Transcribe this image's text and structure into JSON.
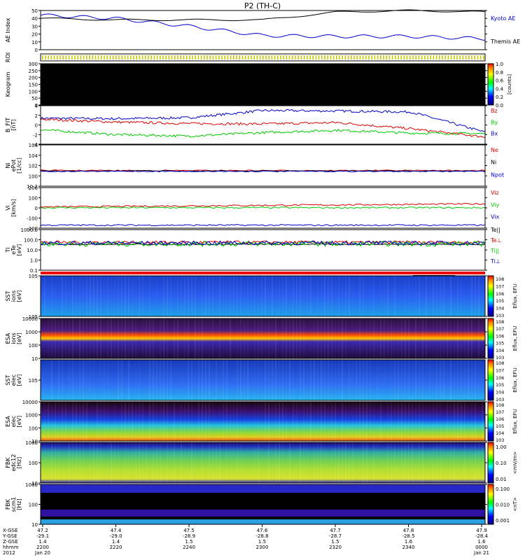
{
  "title": "P2 (TH-C)",
  "panels": {
    "ae": {
      "ylabel": "AE Index",
      "unit": "",
      "ticks": [
        "50",
        "40",
        "30",
        "20",
        "10",
        "0"
      ],
      "series": [
        {
          "name": "Kyoto AE",
          "color": "#0000cc"
        },
        {
          "name": "Themis AE",
          "color": "#000000"
        }
      ]
    },
    "roi": {
      "ylabel": "ROI"
    },
    "keogram": {
      "ylabel": "Keogram",
      "ticks": [
        "300",
        "250",
        "200",
        "150",
        "100",
        "50",
        "0"
      ],
      "cbar_ticks": [
        "1.0",
        "0.8",
        "0.6",
        "0.4",
        "0.2",
        "0.0"
      ],
      "cbar_unit": "[counts]"
    },
    "bfield": {
      "ylabel": "B_FIT",
      "unit": "[nT]",
      "ticks": [
        "4",
        "2",
        "0",
        "-2",
        "-4"
      ],
      "series": [
        {
          "name": "Bz",
          "color": "#dd0000"
        },
        {
          "name": "By",
          "color": "#00cc00"
        },
        {
          "name": "Bx",
          "color": "#0000cc"
        }
      ]
    },
    "density": {
      "ylabel": "Ni",
      "unit": "[1/cc]",
      "sub": "ePot",
      "ticks": [
        "10^6",
        "10^4",
        "10^2",
        "10^0",
        "10^-2"
      ],
      "series": [
        {
          "name": "Ne",
          "color": "#dd0000"
        },
        {
          "name": "Ni",
          "color": "#000000"
        },
        {
          "name": "Npot",
          "color": "#0000cc"
        }
      ]
    },
    "velocity": {
      "ylabel": "Vi",
      "unit": "[km/s]",
      "ticks": [
        "200",
        "100",
        "0",
        "-100",
        "-200"
      ],
      "series": [
        {
          "name": "Viz",
          "color": "#dd0000"
        },
        {
          "name": "Viy",
          "color": "#00cc00"
        },
        {
          "name": "Vix",
          "color": "#0000cc"
        }
      ]
    },
    "temp": {
      "ylabel": "Ti",
      "unit": "[eV]",
      "sub": "eTe",
      "ticks": [
        "1000.0",
        "100.0",
        "10.0",
        "1.0",
        "0.1"
      ],
      "series": [
        {
          "name": "Te||",
          "color": "#000000"
        },
        {
          "name": "Te⊥",
          "color": "#dd0000"
        },
        {
          "name": "Ti||",
          "color": "#00cc00"
        },
        {
          "name": "Ti⊥",
          "color": "#0000cc"
        }
      ]
    },
    "sst_i": {
      "ylabel": "SST",
      "sub": "ions",
      "unit": "[eV]",
      "ticks": [
        "10^5",
        "10^5"
      ]
    },
    "esa_i": {
      "ylabel": "ESA",
      "sub": "ions",
      "unit": "[eV]",
      "ticks": [
        "10000",
        "1000",
        "100",
        "10"
      ]
    },
    "sst_e": {
      "ylabel": "SST",
      "sub": "elec",
      "unit": "[eV]",
      "ticks": [
        "10^5"
      ]
    },
    "esa_e": {
      "ylabel": "ESA",
      "sub": "elec",
      "unit": "[eV]",
      "ticks": [
        "10000",
        "1000",
        "100",
        "10"
      ]
    },
    "fbk_e": {
      "ylabel": "FBK",
      "sub": "edc12",
      "unit": "[Hz]",
      "ticks": [
        "1000",
        "100",
        "10"
      ],
      "cbar_ticks": [
        "1.00",
        "0.10",
        "0.01"
      ],
      "cbar_unit": "<mV/m>"
    },
    "fbk_b": {
      "ylabel": "FBK",
      "sub": "scm1",
      "unit": "[Hz]",
      "ticks": [
        "1000",
        "100",
        "10"
      ],
      "cbar_ticks": [
        "0.100",
        "0.010",
        "0.001"
      ],
      "cbar_unit": "<nT>"
    }
  },
  "eflux": {
    "unit": "Eflux, EFU",
    "ticks": [
      "10^8",
      "10^7",
      "10^6",
      "10^5",
      "10^4",
      "10^3"
    ]
  },
  "x_axis": {
    "row_labels": [
      "X-GSE",
      "Y-GSE",
      "Z-GSE",
      "hhmm",
      "2012"
    ],
    "columns": [
      {
        "x": "47.2",
        "y": "-29.1",
        "z": "1.4",
        "t": "2200",
        "d": "Jan 20"
      },
      {
        "x": "47.4",
        "y": "-29.0",
        "z": "1.4",
        "t": "2220",
        "d": ""
      },
      {
        "x": "47.5",
        "y": "-28.9",
        "z": "1.5",
        "t": "2240",
        "d": ""
      },
      {
        "x": "47.6",
        "y": "-28.8",
        "z": "1.5",
        "t": "2300",
        "d": ""
      },
      {
        "x": "47.7",
        "y": "-28.7",
        "z": "1.5",
        "t": "2320",
        "d": ""
      },
      {
        "x": "47.8",
        "y": "-28.5",
        "z": "1.6",
        "t": "2340",
        "d": ""
      },
      {
        "x": "47.9",
        "y": "-28.4",
        "z": "1.6",
        "t": "0000",
        "d": "Jan 21"
      }
    ]
  },
  "chart_data": {
    "type": "line",
    "title": "P2 (TH-C)",
    "x": [
      "2200",
      "2220",
      "2240",
      "2300",
      "2320",
      "2340",
      "0000"
    ],
    "series": [
      {
        "name": "Kyoto AE",
        "values": [
          44,
          40,
          30,
          18,
          17,
          17,
          14
        ]
      },
      {
        "name": "Themis AE",
        "values": [
          40,
          38,
          38,
          38,
          48,
          50,
          48
        ]
      },
      {
        "name": "Bz",
        "values": [
          1.2,
          0.6,
          0.3,
          0.2,
          0.5,
          -0.8,
          -2.5
        ]
      },
      {
        "name": "By",
        "values": [
          -1.0,
          -2.0,
          -2.3,
          -1.6,
          -1.1,
          -1.7,
          -1.8
        ]
      },
      {
        "name": "Bx",
        "values": [
          1.4,
          1.3,
          1.5,
          3.0,
          2.9,
          2.7,
          -1.5
        ]
      }
    ],
    "xlabel": "hhmm",
    "ylabel": "AE Index"
  }
}
